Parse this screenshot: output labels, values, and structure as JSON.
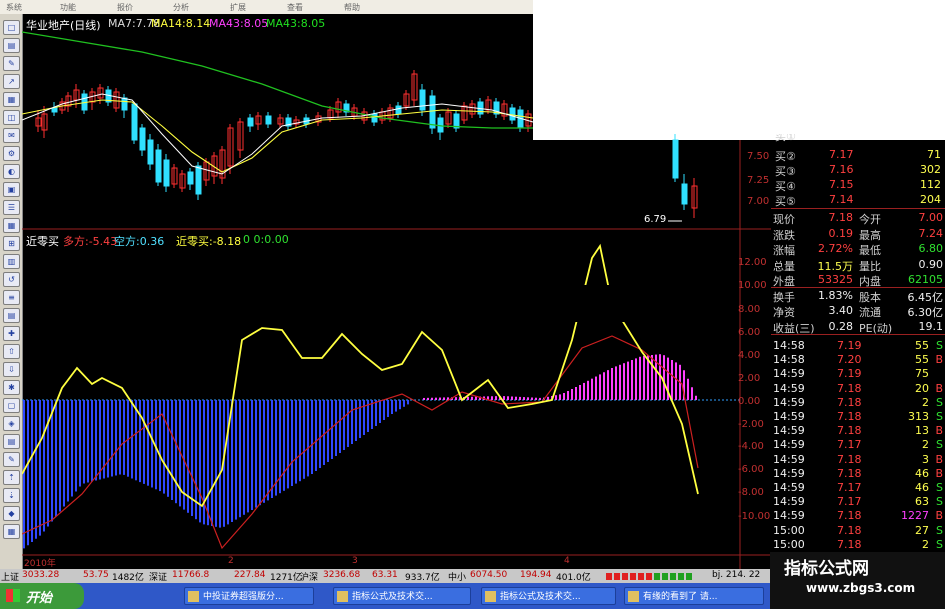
{
  "menu": [
    "系统",
    "功能",
    "报价",
    "分析",
    "扩展",
    "查看",
    "帮助"
  ],
  "title": "华业地产(日线)",
  "ma": [
    {
      "label": "MA7:7.78",
      "color": "#ffffff"
    },
    {
      "label": "MA14:8.14",
      "color": "#ffff40"
    },
    {
      "label": "MA43:8.05",
      "color": "#ff40ff"
    },
    {
      "label": "MA43:8.05",
      "color": "#20e020"
    }
  ],
  "price_axis": [
    "7.50",
    "7.25",
    "7.00"
  ],
  "low_marker": "6.79",
  "indicator": {
    "name": "近零买",
    "items": [
      {
        "label": "多方:-5.43",
        "color": "#ff4040"
      },
      {
        "label": "空方:0.36",
        "color": "#50e0ff"
      },
      {
        "label": "近零买:-8.18",
        "color": "#ffff40"
      },
      {
        "label": "0 0:0.00",
        "color": "#30e030"
      }
    ],
    "axis": [
      "12.00",
      "10.00",
      "8.00",
      "6.00",
      "4.00",
      "2.00",
      "0.00",
      "-2.00",
      "-4.00",
      "-6.00",
      "-8.00",
      "-10.00"
    ]
  },
  "date_axis": [
    "2010年",
    "2",
    "3",
    "4"
  ],
  "quote": {
    "bids": [
      {
        "label": "买②",
        "price": "7.17",
        "vol": "71"
      },
      {
        "label": "买③",
        "price": "7.16",
        "vol": "302"
      },
      {
        "label": "买④",
        "price": "7.15",
        "vol": "112"
      },
      {
        "label": "买⑤",
        "price": "7.14",
        "vol": "204"
      }
    ],
    "bid1_partial": "买①",
    "stats": [
      {
        "l1": "现价",
        "v1": "7.18",
        "c1": "red",
        "l2": "今开",
        "v2": "7.00",
        "c2": "red"
      },
      {
        "l1": "涨跌",
        "v1": "0.19",
        "c1": "red",
        "l2": "最高",
        "v2": "7.24",
        "c2": "red"
      },
      {
        "l1": "涨幅",
        "v1": "2.72%",
        "c1": "red",
        "l2": "最低",
        "v2": "6.80",
        "c2": "grn"
      },
      {
        "l1": "总量",
        "v1": "11.5万",
        "c1": "yel",
        "l2": "量比",
        "v2": "0.90",
        "c2": "wht"
      },
      {
        "l1": "外盘",
        "v1": "53325",
        "c1": "red",
        "l2": "内盘",
        "v2": "62105",
        "c2": "grn"
      },
      {
        "l1": "换手",
        "v1": "1.83%",
        "c1": "wht",
        "l2": "股本",
        "v2": "6.45亿",
        "c2": "wht"
      },
      {
        "l1": "净资",
        "v1": "3.40",
        "c1": "wht",
        "l2": "流通",
        "v2": "6.30亿",
        "c2": "wht"
      },
      {
        "l1": "收益(三)",
        "v1": "0.28",
        "c1": "wht",
        "l2": "PE(动)",
        "v2": "19.1",
        "c2": "wht"
      }
    ],
    "ticks": [
      {
        "t": "14:58",
        "p": "7.19",
        "v": "55",
        "s": "S"
      },
      {
        "t": "14:58",
        "p": "7.20",
        "v": "55",
        "s": "B"
      },
      {
        "t": "14:59",
        "p": "7.19",
        "v": "75",
        "s": ""
      },
      {
        "t": "14:59",
        "p": "7.18",
        "v": "20",
        "s": "B"
      },
      {
        "t": "14:59",
        "p": "7.18",
        "v": "2",
        "s": "S"
      },
      {
        "t": "14:59",
        "p": "7.18",
        "v": "313",
        "s": "S"
      },
      {
        "t": "14:59",
        "p": "7.18",
        "v": "13",
        "s": "B"
      },
      {
        "t": "14:59",
        "p": "7.17",
        "v": "2",
        "s": "S"
      },
      {
        "t": "14:59",
        "p": "7.18",
        "v": "3",
        "s": "B"
      },
      {
        "t": "14:59",
        "p": "7.18",
        "v": "46",
        "s": "B"
      },
      {
        "t": "14:59",
        "p": "7.17",
        "v": "46",
        "s": "S"
      },
      {
        "t": "14:59",
        "p": "7.17",
        "v": "63",
        "s": "S"
      },
      {
        "t": "14:59",
        "p": "7.18",
        "v": "1227",
        "s": "B"
      },
      {
        "t": "15:00",
        "p": "7.18",
        "v": "27",
        "s": "S"
      },
      {
        "t": "15:00",
        "p": "7.18",
        "v": "2",
        "s": "S"
      }
    ]
  },
  "status": {
    "sh_label": "上证",
    "sh_val": "3033.28",
    "sh_chg": "53.75",
    "sh_amt": "1482亿",
    "sz_label": "深证",
    "sz_val": "11766.8",
    "sz_chg": "227.84",
    "sz_amt": "1271亿",
    "hs_label": "沪深",
    "hs_val": "3236.68",
    "hs_chg": "63.31",
    "hs_amt": "933.7亿",
    "zx_label": "中小",
    "zx_val": "6074.50",
    "zx_chg": "194.94",
    "zx_amt": "401.0亿",
    "right": "bj. 214. 22"
  },
  "taskbar": {
    "start": "开始",
    "tasks": [
      "中投证券超强版分...",
      "指标公式及技术交...",
      "指标公式及技术交...",
      "有缘的看到了 请..."
    ]
  },
  "watermark": {
    "line1": "指标公式网",
    "line2": "www.zbgs3.com"
  }
}
